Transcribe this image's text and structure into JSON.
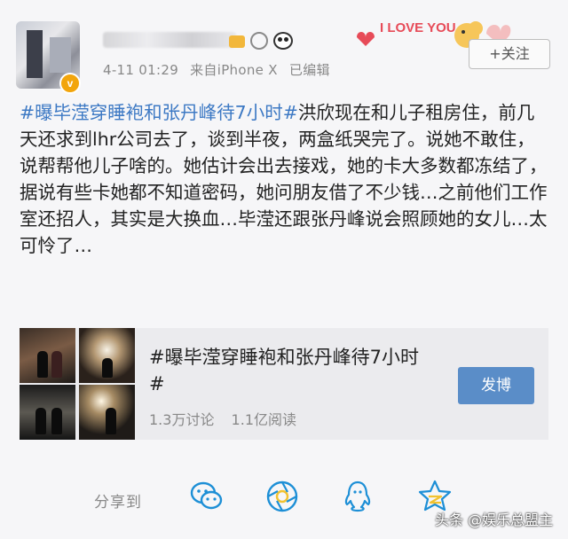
{
  "post": {
    "timestamp": "4-11 01:29",
    "source": "来自iPhone X",
    "edited": "已编辑",
    "love_sticker": "I LOVE YOU",
    "follow_label": "+关注",
    "topic": "#曝毕滢穿睡袍和张丹峰待7小时#",
    "body": "洪欣现在和儿子租房住，前几天还求到lhr公司去了，谈到半夜，两盒纸哭完了。说她不敢住，说帮帮他儿子啥的。她估计会出去接戏，她的卡大多数都冻结了，据说有些卡她都不知道密码，她问朋友借了不少钱…之前他们工作室还招人，其实是大换血…毕滢还跟张丹峰说会照顾她的女儿…太可怜了…"
  },
  "share_card": {
    "title": "#曝毕滢穿睡袍和张丹峰待7小时#",
    "discussions": "1.3万讨论",
    "reads": "1.1亿阅读",
    "post_button": "发博"
  },
  "footer": {
    "share_to": "分享到",
    "icons": [
      "wechat-icon",
      "moments-icon",
      "qq-icon",
      "qzone-icon"
    ],
    "watermark": "头条 @娱乐总盟主"
  },
  "colors": {
    "topic_blue": "#3d79c4",
    "button_blue": "#5a8dc8",
    "icon_blue": "#1d8fd6",
    "icon_yellow": "#f2c230"
  }
}
